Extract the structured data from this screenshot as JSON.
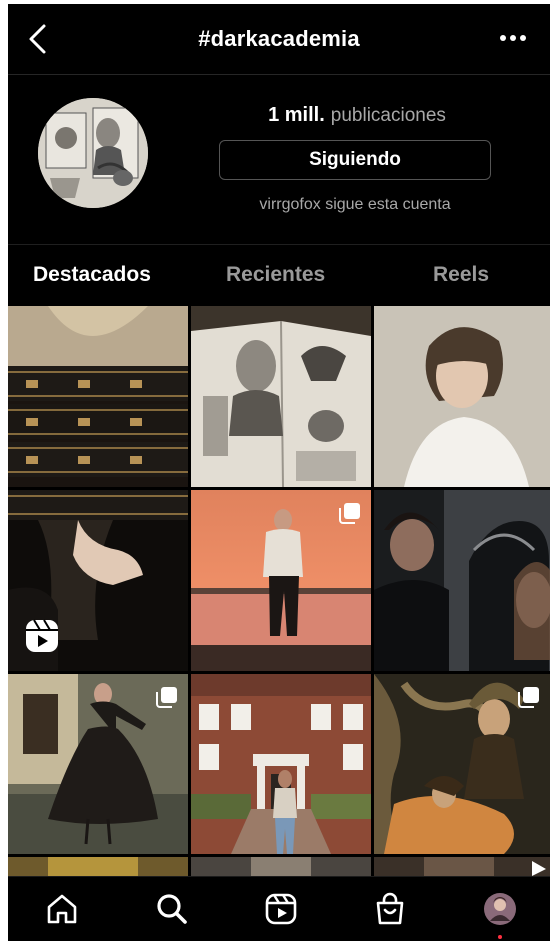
{
  "header": {
    "title": "#darkacademia",
    "back_icon": "chevron-left-icon",
    "more_icon": "more-horizontal-icon"
  },
  "profile": {
    "post_count": "1 mill.",
    "post_label": "publicaciones",
    "follow_button": "Siguiendo",
    "followed_by_text": "virrgofox sigue esta cuenta"
  },
  "tabs": [
    {
      "label": "Destacados",
      "active": true
    },
    {
      "label": "Recientes",
      "active": false
    },
    {
      "label": "Reels",
      "active": false
    }
  ],
  "grid": {
    "badges": [
      {
        "tile": 2,
        "icon": "multiple-photos-icon"
      },
      {
        "tile": 4,
        "icon": "reel-icon"
      },
      {
        "tile": 5,
        "icon": "multiple-photos-icon"
      },
      {
        "tile": 7,
        "icon": "multiple-photos-icon"
      },
      {
        "tile": 9,
        "icon": "multiple-photos-icon"
      }
    ]
  },
  "nav": {
    "items": [
      "home-icon",
      "search-icon",
      "reels-icon",
      "shop-icon",
      "profile-avatar"
    ],
    "accent": "#ff3040"
  },
  "colors": {
    "background": "#000000",
    "text": "#ffffff",
    "muted": "#a8a8a8"
  }
}
